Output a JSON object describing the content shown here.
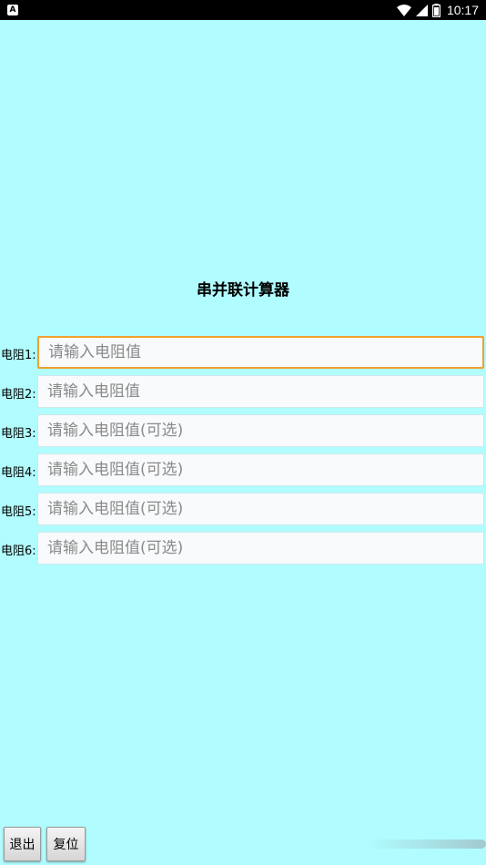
{
  "status_bar": {
    "left_icon_letter": "A",
    "time": "10:17",
    "icons": [
      "wifi-icon",
      "signal-icon",
      "battery-icon"
    ]
  },
  "title": "串并联计算器",
  "rows": [
    {
      "label": "电阻1:",
      "placeholder": "请输入电阻值",
      "value": ""
    },
    {
      "label": "电阻2:",
      "placeholder": "请输入电阻值",
      "value": ""
    },
    {
      "label": "电阻3:",
      "placeholder": "请输入电阻值(可选)",
      "value": ""
    },
    {
      "label": "电阻4:",
      "placeholder": "请输入电阻值(可选)",
      "value": ""
    },
    {
      "label": "电阻5:",
      "placeholder": "请输入电阻值(可选)",
      "value": ""
    },
    {
      "label": "电阻6:",
      "placeholder": "请输入电阻值(可选)",
      "value": ""
    }
  ],
  "buttons": {
    "exit_label": "退出",
    "reset_label": "复位"
  },
  "colors": {
    "background": "#b0fcfe",
    "focus_border": "#f0a030",
    "input_background": "#f8fafc"
  }
}
